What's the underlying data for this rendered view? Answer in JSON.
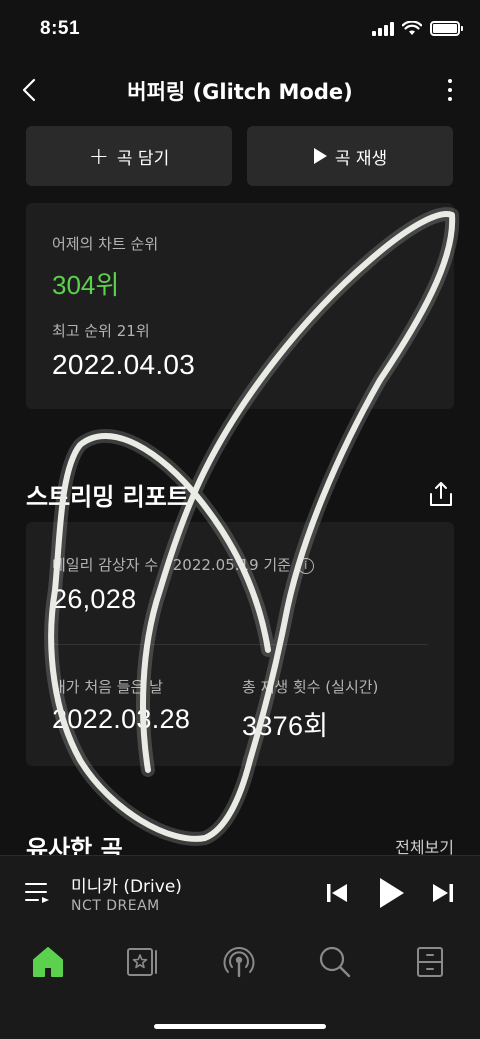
{
  "status": {
    "time": "8:51"
  },
  "nav": {
    "title": "버퍼링 (Glitch Mode)"
  },
  "actions": {
    "add_label": "곡 담기",
    "play_label": "곡 재생"
  },
  "chart": {
    "yesterday_label": "어제의 차트 순위",
    "yesterday_rank": "304위",
    "best_label": "최고 순위 21위",
    "best_date": "2022.04.03"
  },
  "report": {
    "title": "스트리밍 리포트",
    "daily_label": "데일리 감상자 수 / 2022.05.19 기준",
    "daily_value": "26,028",
    "first_listen_label": "내가 처음 들은 날",
    "first_listen_value": "2022.03.28",
    "play_count_label": "총 재생 횟수 (실시간)",
    "play_count_value": "3376회"
  },
  "similar": {
    "title": "유사한 곡",
    "see_all": "전체보기"
  },
  "player": {
    "title": "미니카 (Drive)",
    "artist": "NCT DREAM"
  },
  "tabs": [
    "home-icon",
    "library-icon",
    "podcast-icon",
    "search-icon",
    "storage-icon"
  ],
  "colors": {
    "accent": "#5bd14d",
    "background": "#121212",
    "card": "#1e1e1e"
  }
}
